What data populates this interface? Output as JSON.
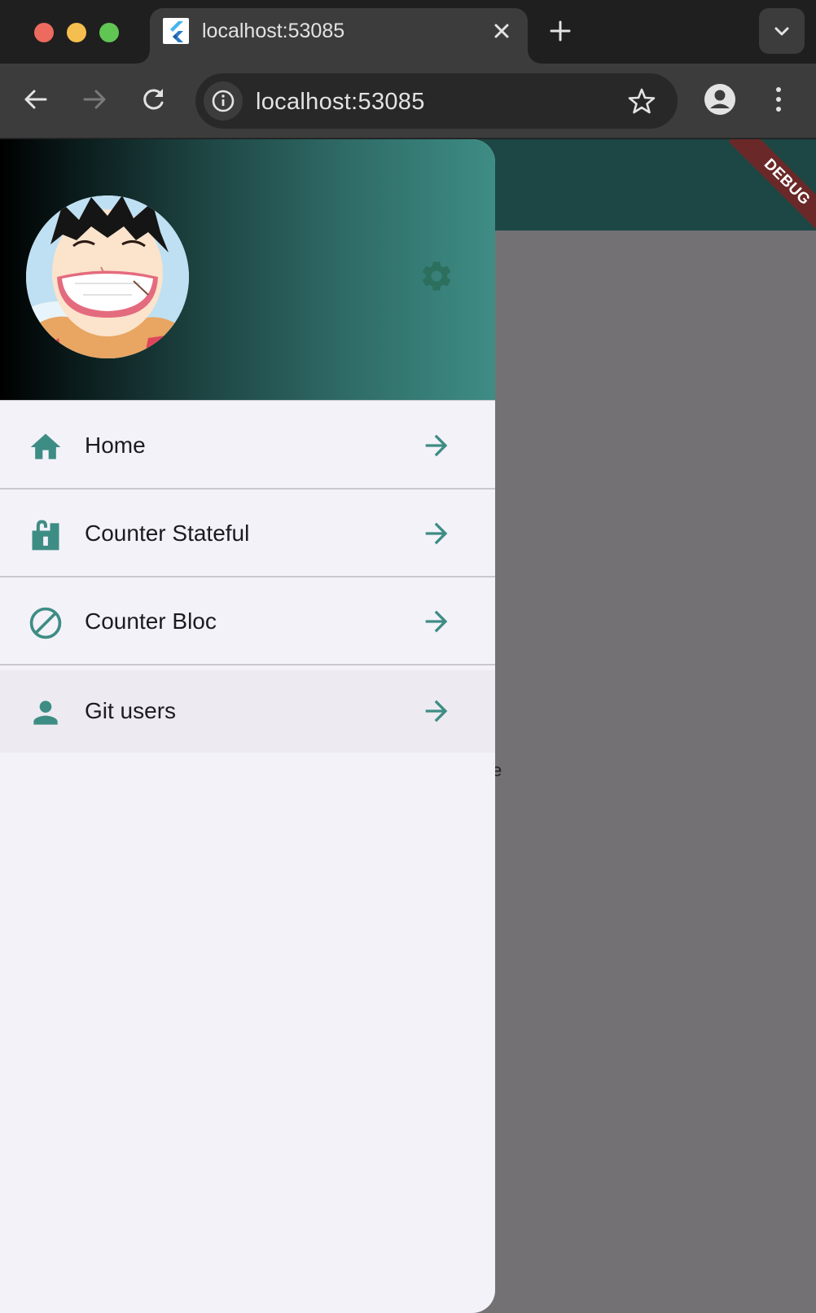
{
  "browser": {
    "tab": {
      "title": "localhost:53085",
      "favicon": "flutter-logo-icon"
    },
    "address_bar": {
      "url": "localhost:53085"
    },
    "icons": {
      "close_tab": "close-icon",
      "new_tab": "plus-icon",
      "tab_search": "chevron-down-icon",
      "back": "arrow-left-icon",
      "forward": "arrow-right-icon",
      "reload": "reload-icon",
      "site_info": "info-icon",
      "bookmark": "star-icon",
      "profile": "profile-icon",
      "menu": "kebab-menu-icon"
    }
  },
  "app": {
    "debug_banner": "DEBUG",
    "colors": {
      "app_bar": "#1c4744",
      "accent": "#3e8d85",
      "drawer_bg": "#f4f2f9",
      "scrim": "#747175",
      "debug_banner": "#6b2828"
    },
    "drawer": {
      "header": {
        "avatar": "avatar-image",
        "settings_icon": "gear-icon"
      },
      "items": [
        {
          "label": "Home",
          "icon": "home-icon",
          "trailing": "arrow-forward-icon"
        },
        {
          "label": "Counter Stateful",
          "icon": "lock-open-icon",
          "trailing": "arrow-forward-icon"
        },
        {
          "label": "Counter Bloc",
          "icon": "block-icon",
          "trailing": "arrow-forward-icon"
        },
        {
          "label": "Git users",
          "icon": "person-icon",
          "trailing": "arrow-forward-icon",
          "highlighted": true
        }
      ]
    }
  }
}
